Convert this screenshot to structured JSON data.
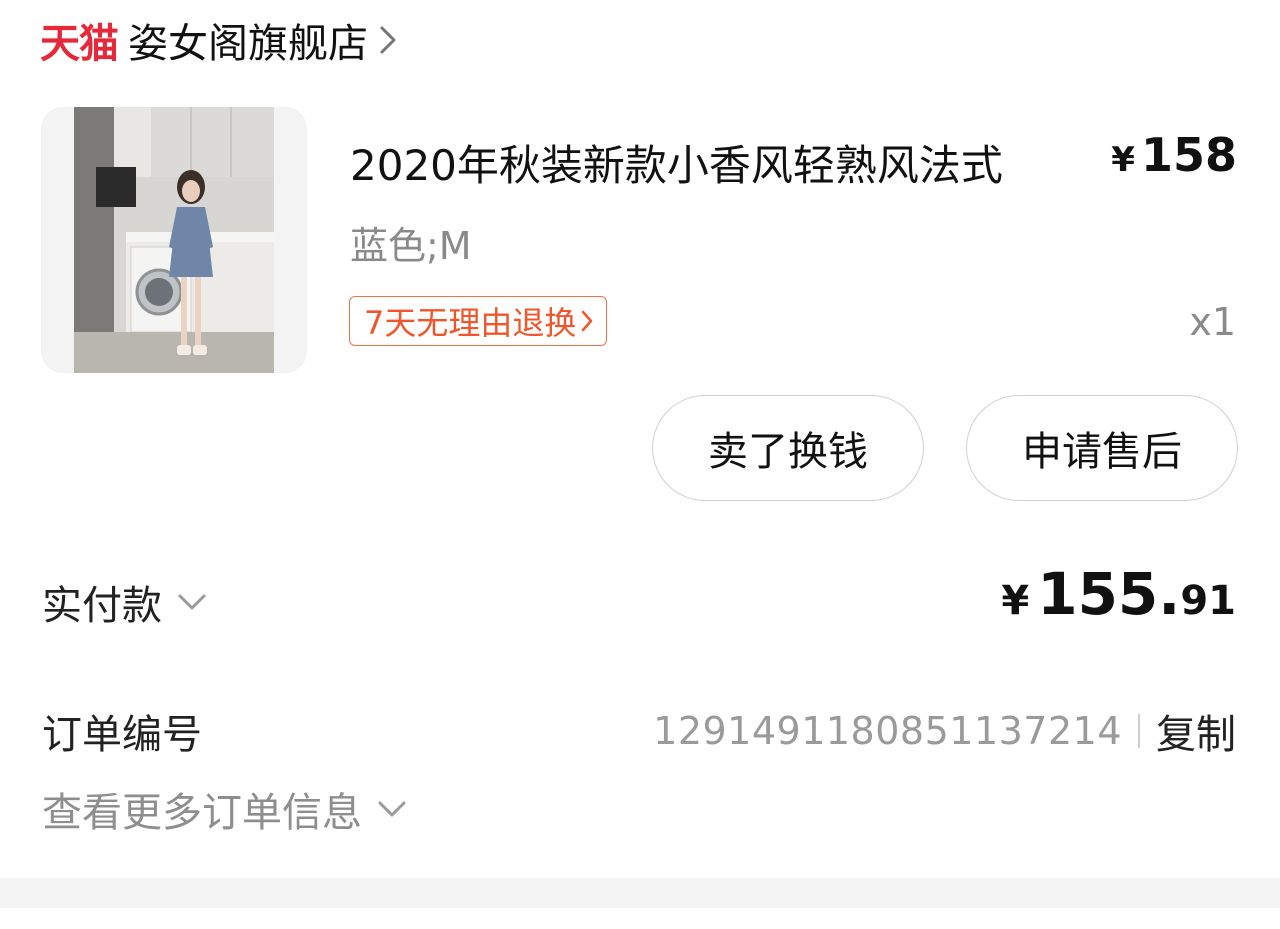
{
  "store": {
    "platform_logo": "天猫",
    "name": "姿女阁旗舰店",
    "brand_color": "#e5293b",
    "chevron_icon": "chevron-right-icon"
  },
  "product": {
    "title": "2020年秋装新款小香风轻熟风法式",
    "price_symbol": "¥",
    "price": "158",
    "sku": "蓝色;M",
    "return_policy": "7天无理由退换",
    "return_policy_icon": "chevron-right-icon",
    "quantity": "x1",
    "image_description_icon": "product-photo"
  },
  "actions": {
    "sell_label": "卖了换钱",
    "after_sales_label": "申请售后"
  },
  "payment": {
    "label": "实付款",
    "currency": "¥",
    "amount_int": "155.",
    "amount_dec": "91"
  },
  "order": {
    "number_label": "订单编号",
    "number": "1291491180851137214",
    "copy_label": "复制",
    "more_info_label": "查看更多订单信息"
  }
}
